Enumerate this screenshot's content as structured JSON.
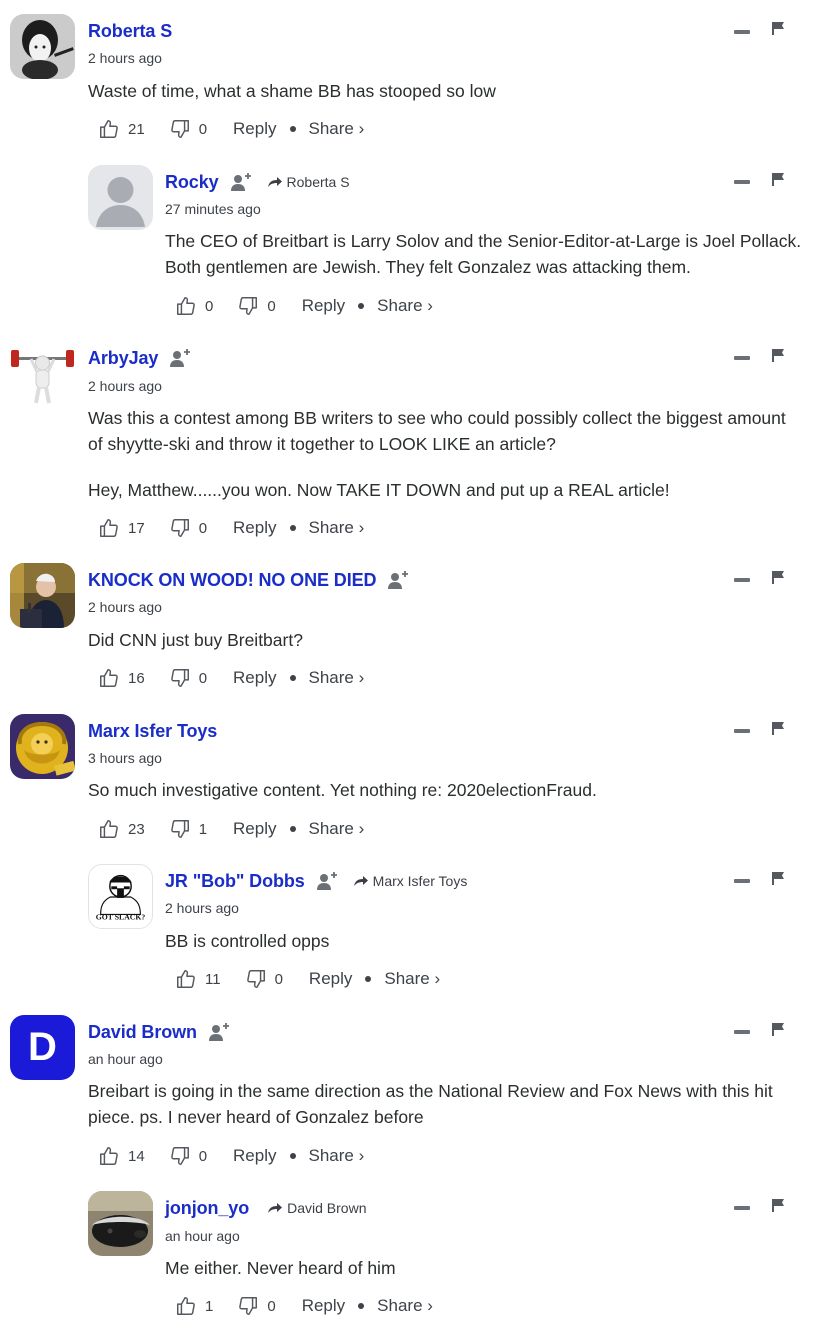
{
  "colors": {
    "author": "#1a2dc8",
    "text": "#2a2e2e",
    "muted": "#3e4349"
  },
  "comments": [
    {
      "author": "Roberta S",
      "time": "2 hours ago",
      "text": [
        "Waste of time, what a shame BB has stooped so low"
      ],
      "upvotes": "21",
      "downvotes": "0",
      "reply_label": "Reply",
      "share_label": "Share ›",
      "follow": false,
      "reply_to": null,
      "avatar": "portrait-bw"
    },
    {
      "author": "Rocky",
      "time": "27 minutes ago",
      "text": [
        "The CEO of Breitbart is Larry Solov and the Senior-Editor-at-Large is Joel Pollack. Both gentlemen are Jewish. They felt Gonzalez was attacking them."
      ],
      "upvotes": "0",
      "downvotes": "0",
      "reply_label": "Reply",
      "share_label": "Share ›",
      "follow": true,
      "reply_to": "Roberta S",
      "avatar": "default-user"
    },
    {
      "author": "ArbyJay",
      "time": "2 hours ago",
      "text": [
        "Was this a contest among BB writers to see who could possibly collect the biggest amount of shyytte-ski and throw it together to LOOK LIKE an article?",
        "Hey, Matthew......you won. Now TAKE IT DOWN and put up a REAL article!"
      ],
      "upvotes": "17",
      "downvotes": "0",
      "reply_label": "Reply",
      "share_label": "Share ›",
      "follow": true,
      "reply_to": null,
      "avatar": "weightlifter"
    },
    {
      "author": "KNOCK ON WOOD! NO ONE DIED",
      "time": "2 hours ago",
      "text": [
        "Did CNN just buy Breitbart?"
      ],
      "upvotes": "16",
      "downvotes": "0",
      "reply_label": "Reply",
      "share_label": "Share ›",
      "follow": true,
      "reply_to": null,
      "avatar": "man-podium"
    },
    {
      "author": "Marx Isfer Toys",
      "time": "3 hours ago",
      "text": [
        "So much investigative content. Yet nothing re: 2020electionFraud."
      ],
      "upvotes": "23",
      "downvotes": "1",
      "reply_label": "Reply",
      "share_label": "Share ›",
      "follow": false,
      "reply_to": null,
      "avatar": "marx-yellow"
    },
    {
      "author": "JR \"Bob\" Dobbs",
      "time": "2 hours ago",
      "text": [
        "BB is controlled opps"
      ],
      "upvotes": "11",
      "downvotes": "0",
      "reply_label": "Reply",
      "share_label": "Share ›",
      "follow": true,
      "reply_to": "Marx Isfer Toys",
      "avatar": "got-slack",
      "avatar_caption": "GOT SLACK?"
    },
    {
      "author": "David Brown",
      "time": "an hour ago",
      "text": [
        "Breibart is going in the same direction as the National Review and Fox News with this hit piece. ps. I never heard of Gonzalez before"
      ],
      "upvotes": "14",
      "downvotes": "0",
      "reply_label": "Reply",
      "share_label": "Share ›",
      "follow": true,
      "reply_to": null,
      "avatar": "letter-d",
      "avatar_letter": "D"
    },
    {
      "author": "jonjon_yo",
      "time": "an hour ago",
      "text": [
        "Me either. Never heard of him"
      ],
      "upvotes": "1",
      "downvotes": "0",
      "reply_label": "Reply",
      "share_label": "Share ›",
      "follow": false,
      "reply_to": "David Brown",
      "avatar": "honey-badger"
    }
  ]
}
